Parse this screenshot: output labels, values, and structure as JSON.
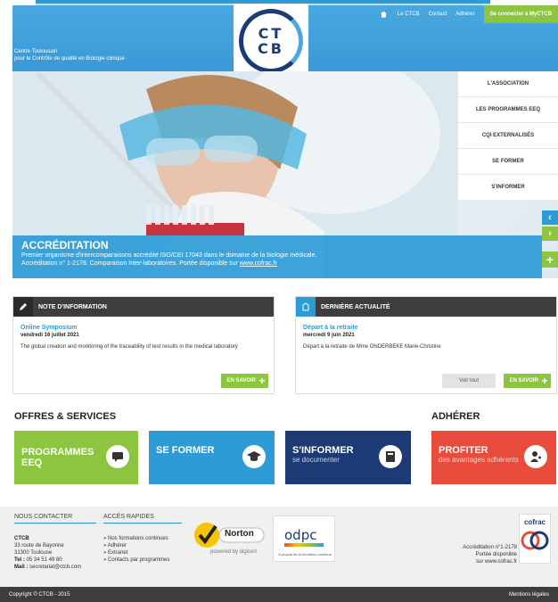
{
  "header": {
    "util_nav": {
      "home_icon": "home-icon",
      "le_ctcb": "Le CTCB",
      "contact": "Contact",
      "adherer": "Adhérer",
      "connect": "Se connecter à MyCTCB"
    },
    "center_line1": "Centre Toulousain",
    "center_line2": "pour le Contrôle de qualité en Biologie clinique",
    "logo_line1": "CT",
    "logo_line2": "CB"
  },
  "hero_menu": [
    {
      "label": "L'ASSOCIATION"
    },
    {
      "label": "LES PROGRAMMES EEQ"
    },
    {
      "label": "CQI EXTERNALISÉS"
    },
    {
      "label": "SE FORMER"
    },
    {
      "label": "S'INFORMER"
    }
  ],
  "hero_arrows": {
    "prev": "‹",
    "next": "›"
  },
  "hero_band": {
    "title": "ACCRÉDITATION",
    "line1": "Premier organisme d'intercomparaisons accrédité ISO/CEI 17043 dans le domaine de la biologie médicale.",
    "line2_prefix": "Accréditation n° 1-2178. Comparaison Inter-laboratoires. Portée disponible sur ",
    "line2_link": "www.cofrac.fr",
    "plus": "+"
  },
  "note_panel": {
    "heading": "NOTE D'INFORMATION",
    "icon": "pencil-icon",
    "title": "Online Symposium",
    "date": "vendredi 16 juillet 2021",
    "text": "The global creation and monitoring of the traceability of test results in the medical laboratory",
    "button": "EN SAVOIR",
    "plus": "+"
  },
  "news_panel": {
    "heading": "DERNIÈRE ACTUALITÉ",
    "icon": "news-icon",
    "title": "Départ à la retraite",
    "date": "mercredi 9 juin 2021",
    "text": "Départ à la retraite de Mme ONDERBEKE Marie-Christine",
    "voir_tout": "Voir tout",
    "button": "EN SAVOIR",
    "plus": "+"
  },
  "sections": {
    "offres": "OFFRES & SERVICES",
    "adherer": "ADHÉRER"
  },
  "tiles": [
    {
      "main": "PROGRAMMES",
      "main2": "EEQ",
      "sub": "",
      "color": "#8cc53f",
      "icon": "chat-icon"
    },
    {
      "main": "SE FORMER",
      "main2": "",
      "sub": "",
      "color": "#2d9bd6",
      "icon": "graduation-cap-icon"
    },
    {
      "main": "S'INFORMER",
      "main2": "",
      "sub": "se documenter",
      "color": "#1c3a73",
      "icon": "book-icon"
    },
    {
      "main": "PROFITER",
      "main2": "",
      "sub": "des avantages adhérents",
      "color": "#e84c3d",
      "icon": "member-icon"
    }
  ],
  "footer": {
    "contact_title": "NOUS CONTACTER",
    "links_title": "ACCÈS RAPIDES",
    "org": "CTCB",
    "addr1": "33 route de Bayonne",
    "addr2": "31300 Toulouse",
    "tel_label": "Tel :",
    "tel": "05 34 51 49 80",
    "mail_label": "Mail :",
    "mail": "secretariat@ctcb.com",
    "links": [
      "» Nos formations continues",
      "» Adhérer",
      "» Extranet",
      "» Contacts par programmes"
    ],
    "norton": "Norton",
    "norton_sub": "powered by digicert",
    "odpc": "odpc",
    "odpc_sub": "A propos de la formation continue",
    "cofrac_logo": "cofrac",
    "cofrac_line1": "Accréditation n°1-2178",
    "cofrac_line2": "Portée disponible",
    "cofrac_line3": "sur www.cofrac.fr"
  },
  "copyright": {
    "left": "Copyright © CTCB - 2015",
    "right": "Mentions légales"
  }
}
